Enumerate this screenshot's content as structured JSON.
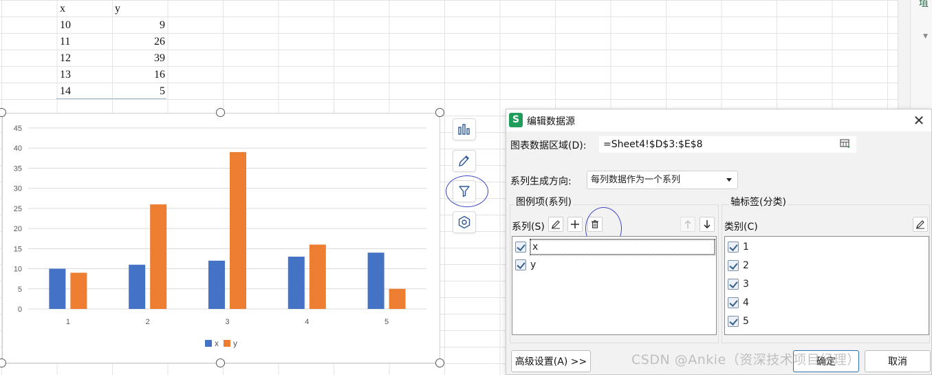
{
  "sheet": {
    "headers": {
      "x": "x",
      "y": "y"
    },
    "rows": [
      {
        "x": "10",
        "y": "9"
      },
      {
        "x": "11",
        "y": "26"
      },
      {
        "x": "12",
        "y": "39"
      },
      {
        "x": "13",
        "y": "16"
      },
      {
        "x": "14",
        "y": "5"
      }
    ]
  },
  "chart_data": {
    "type": "bar",
    "categories": [
      "1",
      "2",
      "3",
      "4",
      "5"
    ],
    "series": [
      {
        "name": "x",
        "values": [
          10,
          11,
          12,
          13,
          14
        ],
        "color": "#4472C4"
      },
      {
        "name": "y",
        "values": [
          9,
          26,
          39,
          16,
          5
        ],
        "color": "#ED7D31"
      }
    ],
    "yticks": [
      "0",
      "5",
      "10",
      "15",
      "20",
      "25",
      "30",
      "35",
      "40",
      "45"
    ],
    "ylim": [
      0,
      45
    ],
    "grid": true,
    "legend": "bottom"
  },
  "quick_toolbar": {
    "items": [
      "chart-elements-icon",
      "chart-style-icon",
      "chart-filter-icon",
      "chart-settings-icon"
    ]
  },
  "side_panel": {
    "glyph": "埴"
  },
  "dialog": {
    "logo": "S",
    "title": "编辑数据源",
    "range_label": "图表数据区域(D):",
    "range_value": "=Sheet4!$D$3:$E$8",
    "direction_label": "系列生成方向:",
    "direction_value": "每列数据作为一个系列",
    "legend_group_label": "图例项(系列)",
    "series_label": "系列(S)",
    "series_items": [
      "x",
      "y"
    ],
    "axis_group_label": "轴标签(分类)",
    "category_label": "类别(C)",
    "category_items": [
      "1",
      "2",
      "3",
      "4",
      "5"
    ],
    "advanced_button": "高级设置(A) >>",
    "ok_button": "确定",
    "cancel_button": "取消"
  },
  "watermark": "CSDN @Ankie（资深技术项目经理）"
}
